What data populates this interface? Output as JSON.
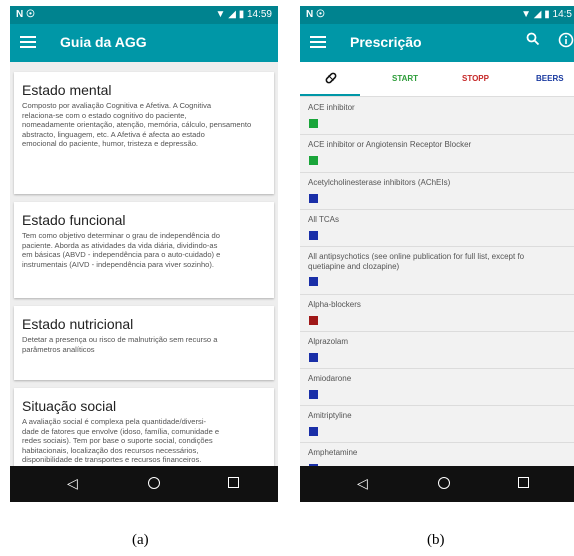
{
  "phone_a": {
    "status": {
      "left": "N ☉",
      "right": "▼ ◢ ▮ 14:59"
    },
    "title": "Guia da AGG",
    "cards": [
      {
        "title": "Estado mental",
        "lines": [
          "Composto por avaliação Cognitiva e Afetiva. A Cognitiva",
          "relaciona-se com o estado cognitivo do paciente,",
          "nomeadamente orientação, atenção, memória, cálculo, pensamento",
          "abstracto, linguagem, etc. A Afetiva é afecta ao estado",
          "emocional do paciente, humor, tristeza e depressão."
        ]
      },
      {
        "title": "Estado funcional",
        "lines": [
          "Tem como objetivo determinar o grau de independência do",
          "paciente. Aborda as atividades da vida diária, dividindo-as",
          "em básicas (ABVD - independência para o auto-cuidado) e",
          "instrumentais (AIVD - independência para viver sozinho)."
        ]
      },
      {
        "title": "Estado nutricional",
        "lines": [
          "Detetar a presença ou risco de malnutrição sem recurso a",
          "parâmetros analíticos"
        ]
      },
      {
        "title": "Situação social",
        "lines": [
          "A avaliação social é complexa pela quantidade/diversi-",
          "dade de fatores que envolve (idoso, família, comunidade e",
          "redes sociais). Tem por base o suporte social, condições",
          "habitacionais, localização dos recursos necessários,",
          "disponibilidade de transportes e recursos financeiros."
        ]
      }
    ]
  },
  "phone_b": {
    "status": {
      "left": "N ☉",
      "right": "▼ ◢ ▮ 14:5"
    },
    "title": "Prescrição",
    "tabs": [
      {
        "label": "💊",
        "color": "#111111"
      },
      {
        "label": "START",
        "color": "#2e9d3a"
      },
      {
        "label": "STOPP",
        "color": "#c62828"
      },
      {
        "label": "BEERS",
        "color": "#1a3aa0"
      }
    ],
    "rows": [
      {
        "lines": [
          "ACE inhibitor"
        ],
        "color": "#1aa53a"
      },
      {
        "lines": [
          "ACE inhibitor or Angiotensin Receptor Blocker"
        ],
        "color": "#1aa53a"
      },
      {
        "lines": [
          "Acetylcholinesterase inhibitors (AChEIs)"
        ],
        "color": "#1a2fa8"
      },
      {
        "lines": [
          "All TCAs"
        ],
        "color": "#1a2fa8"
      },
      {
        "lines": [
          "All antipsychotics (see online publication for full list, except fo",
          "quetiapine and clozapine)"
        ],
        "color": "#1a2fa8"
      },
      {
        "lines": [
          "Alpha-blockers"
        ],
        "color": "#a01818"
      },
      {
        "lines": [
          "Alprazolam"
        ],
        "color": "#1a2fa8"
      },
      {
        "lines": [
          "Amiodarone"
        ],
        "color": "#1a2fa8"
      },
      {
        "lines": [
          "Amitriptyline"
        ],
        "color": "#1a2fa8"
      },
      {
        "lines": [
          "Amphetamine"
        ],
        "color": "#1a2fa8"
      }
    ]
  },
  "nav": {
    "back": "◁",
    "home": "",
    "recent": ""
  },
  "captions": {
    "a": "(a)",
    "b": "(b)"
  },
  "icons": {
    "menu": "menu-icon",
    "search": "search-icon",
    "info": "info-icon",
    "pill": "pill-icon"
  }
}
